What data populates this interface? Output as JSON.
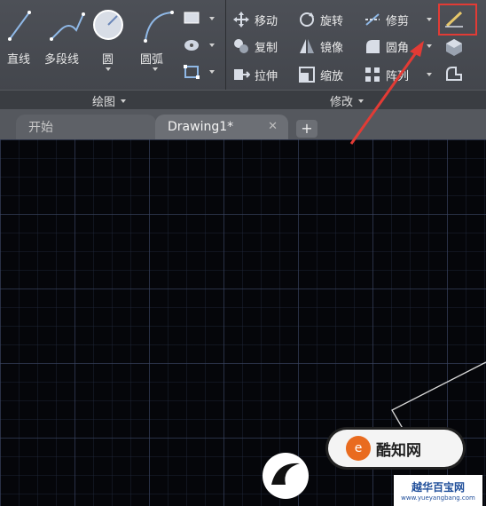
{
  "ribbon": {
    "draw_tools": [
      {
        "name": "line-tool",
        "label": "直线"
      },
      {
        "name": "polyline-tool",
        "label": "多段线"
      },
      {
        "name": "circle-tool",
        "label": "圆"
      },
      {
        "name": "arc-tool",
        "label": "圆弧"
      }
    ],
    "draw_panel_title": "绘图",
    "modify_tools": [
      {
        "name": "move-tool",
        "label": "移动",
        "icon": "move-icon"
      },
      {
        "name": "rotate-tool",
        "label": "旋转",
        "icon": "rotate-icon"
      },
      {
        "name": "trim-tool",
        "label": "修剪",
        "icon": "trim-icon"
      },
      {
        "name": "copy-tool",
        "label": "复制",
        "icon": "copy-icon"
      },
      {
        "name": "mirror-tool",
        "label": "镜像",
        "icon": "mirror-icon"
      },
      {
        "name": "fillet-tool",
        "label": "圆角",
        "icon": "fillet-icon"
      },
      {
        "name": "stretch-tool",
        "label": "拉伸",
        "icon": "stretch-icon"
      },
      {
        "name": "scale-tool",
        "label": "缩放",
        "icon": "scale-icon"
      },
      {
        "name": "array-tool",
        "label": "阵列",
        "icon": "array-icon"
      }
    ],
    "modify_panel_title": "修改"
  },
  "tabs": {
    "start": "开始",
    "drawing": "Drawing1*",
    "close": "✕",
    "add": "+"
  },
  "watermark": {
    "badge_text": "酷知网",
    "badge_logo": "e",
    "site_name": "越华百宝网",
    "site_url": "www.yueyangbang.com"
  },
  "colors": {
    "highlight": "#e23b35",
    "arrow": "#e23b35"
  }
}
